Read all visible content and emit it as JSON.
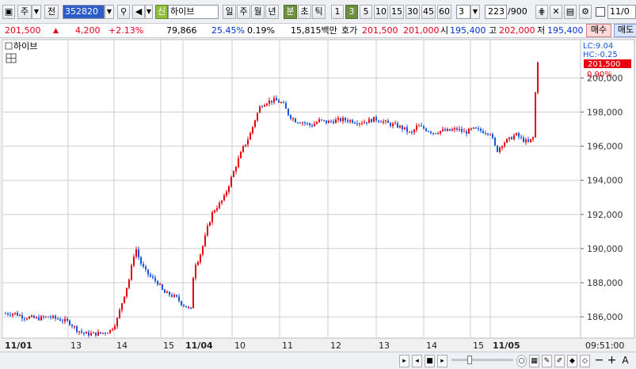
{
  "toolbar": {
    "market": "주",
    "view": "전",
    "code": "352820",
    "type_badge": "신",
    "stock_name": "하이브",
    "periods": [
      "일",
      "주",
      "월",
      "년",
      "분",
      "초",
      "틱"
    ],
    "periods_selected": "분",
    "intervals": [
      "1",
      "3",
      "5",
      "10",
      "15",
      "30",
      "45",
      "60"
    ],
    "interval_selected": "3",
    "interval_value": "3",
    "count": "223",
    "count_max": "/900",
    "date_field": "11/0"
  },
  "quote": {
    "price": "201,500",
    "arrow": "▲",
    "change": "4,200",
    "change_pct": "+2.13%",
    "volume": "79,866",
    "turnover_pct": "25.45%",
    "ratio_pct": "0.19%",
    "amount": "15,815백만",
    "ask_label": "호가",
    "ask": "201,500",
    "bid": "201,000",
    "open_label": "시",
    "open": "195,400",
    "high_label": "고",
    "high": "202,000",
    "low_label": "저",
    "low": "195,400",
    "buy_button": "매수",
    "sell_button": "매도"
  },
  "legend": {
    "series_name": "하이브",
    "lc": "LC:9.04",
    "hc": "HC:-0.25",
    "last_price": "201,500",
    "last_pct": "0.90%"
  },
  "footer": {
    "time": "09:51:00"
  },
  "colors": {
    "up": "#e8000f",
    "down": "#1a55e0",
    "grid": "#c9cdd3",
    "label_bg": "#e8000f"
  },
  "chart_data": {
    "type": "candlestick",
    "y_ticks": [
      "186,000",
      "188,000",
      "190,000",
      "192,000",
      "194,000",
      "196,000",
      "198,000",
      "200,000"
    ],
    "y_tick_values": [
      186000,
      188000,
      190000,
      192000,
      194000,
      196000,
      198000,
      200000
    ],
    "ylim": [
      184800,
      202200
    ],
    "x_tick_labels": [
      "11/01",
      "13",
      "14",
      "15",
      "11/04",
      "10",
      "11",
      "12",
      "13",
      "14",
      "15",
      "11/05"
    ],
    "x_bold_labels": [
      "11/01",
      "11/04",
      "11/05"
    ],
    "close_path": [
      [
        0,
        186200
      ],
      [
        12,
        186200
      ],
      [
        22,
        186000
      ],
      [
        40,
        185900
      ],
      [
        55,
        186000
      ],
      [
        68,
        185850
      ],
      [
        80,
        185700
      ],
      [
        90,
        185250
      ],
      [
        100,
        185000
      ],
      [
        112,
        185000
      ],
      [
        122,
        185050
      ],
      [
        132,
        185200
      ],
      [
        140,
        185700
      ],
      [
        148,
        187000
      ],
      [
        156,
        188200
      ],
      [
        164,
        190100
      ],
      [
        170,
        189200
      ],
      [
        176,
        188700
      ],
      [
        184,
        188300
      ],
      [
        192,
        188000
      ],
      [
        200,
        187400
      ],
      [
        208,
        187300
      ],
      [
        216,
        187100
      ],
      [
        222,
        186800
      ],
      [
        228,
        186600
      ],
      [
        234,
        186400
      ],
      [
        238,
        189000
      ],
      [
        244,
        189400
      ],
      [
        250,
        190300
      ],
      [
        256,
        191400
      ],
      [
        262,
        192200
      ],
      [
        270,
        192600
      ],
      [
        276,
        193000
      ],
      [
        284,
        194000
      ],
      [
        292,
        195000
      ],
      [
        300,
        195900
      ],
      [
        308,
        196600
      ],
      [
        316,
        197700
      ],
      [
        322,
        198400
      ],
      [
        330,
        198600
      ],
      [
        340,
        198700
      ],
      [
        350,
        198500
      ],
      [
        358,
        197800
      ],
      [
        366,
        197500
      ],
      [
        376,
        197400
      ],
      [
        386,
        197200
      ],
      [
        396,
        197500
      ],
      [
        406,
        197400
      ],
      [
        416,
        197500
      ],
      [
        426,
        197550
      ],
      [
        436,
        197500
      ],
      [
        446,
        197400
      ],
      [
        456,
        197450
      ],
      [
        466,
        197600
      ],
      [
        474,
        197500
      ],
      [
        484,
        197300
      ],
      [
        494,
        197200
      ],
      [
        504,
        197000
      ],
      [
        512,
        196700
      ],
      [
        520,
        197200
      ],
      [
        530,
        197000
      ],
      [
        540,
        196800
      ],
      [
        550,
        196900
      ],
      [
        560,
        196900
      ],
      [
        570,
        197000
      ],
      [
        580,
        196800
      ],
      [
        590,
        197000
      ],
      [
        600,
        196900
      ],
      [
        612,
        196800
      ],
      [
        620,
        195700
      ],
      [
        628,
        196200
      ],
      [
        636,
        196400
      ],
      [
        644,
        196700
      ],
      [
        652,
        196400
      ],
      [
        660,
        196200
      ],
      [
        666,
        196500
      ],
      [
        670,
        200000
      ],
      [
        673,
        201500
      ]
    ]
  }
}
